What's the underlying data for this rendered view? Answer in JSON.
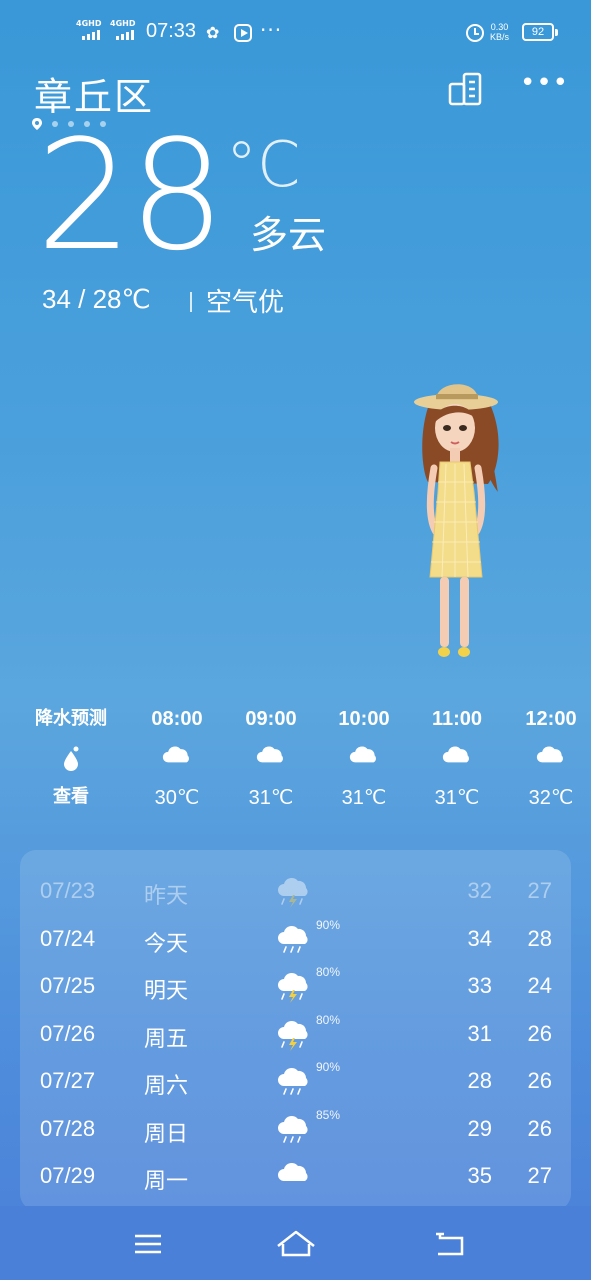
{
  "status_bar": {
    "network1": "4GHD",
    "network2": "4GHD",
    "time": "07:33",
    "speed_value": "0.30",
    "speed_unit": "KB/s",
    "battery": "92"
  },
  "header": {
    "city": "章丘区"
  },
  "current": {
    "temperature": "28",
    "unit": "°C",
    "condition": "多云",
    "range_text": "34  /  28℃",
    "air_quality": "空气优"
  },
  "hourly": {
    "precip_label": "降水预测",
    "precip_action": "查看",
    "items": [
      {
        "time": "08:00",
        "temp": "30℃",
        "icon": "cloud-icon"
      },
      {
        "time": "09:00",
        "temp": "31℃",
        "icon": "cloud-icon"
      },
      {
        "time": "10:00",
        "temp": "31℃",
        "icon": "cloud-icon"
      },
      {
        "time": "11:00",
        "temp": "31℃",
        "icon": "cloud-icon"
      },
      {
        "time": "12:00",
        "temp": "32℃",
        "icon": "cloud-icon"
      }
    ]
  },
  "daily": [
    {
      "date": "07/23",
      "name": "昨天",
      "icon": "thunderstorm-icon",
      "prob": "",
      "high": "32",
      "low": "27"
    },
    {
      "date": "07/24",
      "name": "今天",
      "icon": "rain-icon",
      "prob": "90%",
      "high": "34",
      "low": "28"
    },
    {
      "date": "07/25",
      "name": "明天",
      "icon": "thunderstorm-icon",
      "prob": "80%",
      "high": "33",
      "low": "24"
    },
    {
      "date": "07/26",
      "name": "周五",
      "icon": "thunderstorm-icon",
      "prob": "80%",
      "high": "31",
      "low": "26"
    },
    {
      "date": "07/27",
      "name": "周六",
      "icon": "rain-icon",
      "prob": "90%",
      "high": "28",
      "low": "26"
    },
    {
      "date": "07/28",
      "name": "周日",
      "icon": "rain-icon",
      "prob": "85%",
      "high": "29",
      "low": "26"
    },
    {
      "date": "07/29",
      "name": "周一",
      "icon": "cloud-icon",
      "prob": "",
      "high": "35",
      "low": "27"
    }
  ],
  "colors": {
    "bg_top": "#3a98d8",
    "bg_bottom": "#4a7fd8",
    "text": "#ffffff",
    "dress": "#f3dc8a"
  }
}
